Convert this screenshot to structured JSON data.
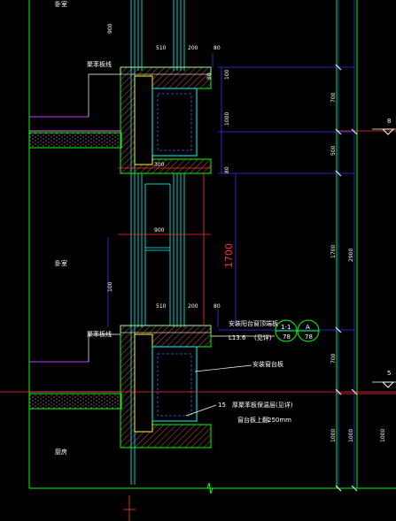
{
  "drawing": {
    "rooms": {
      "top": "卧室",
      "middle": "卧室",
      "bottom": "厨房"
    },
    "labels": {
      "mortar_upper": "聚苯板线",
      "mortar_lower": "聚苯板线",
      "note1": "安装阳台窗顶端板",
      "note1_sub": "L13.6",
      "note1_paren": "(见详)",
      "note2": "安装窗台板",
      "note3_num": "15",
      "note3": "厚聚苯板保温层(见详)",
      "note3_sub": "窗台板上翻",
      "note3_val": "250mm"
    },
    "callouts": [
      {
        "top": "1-1",
        "bottom": "78"
      },
      {
        "top": "A",
        "bottom": "78"
      }
    ],
    "dimensions": {
      "top_900": "900",
      "w510_top": "510",
      "w200_top": "200",
      "w80_top": "80",
      "h100_a": "100",
      "h80_a": "80",
      "h1000": "1000",
      "w300": "300",
      "w80_b": "80",
      "w900": "900",
      "h1700": "1700",
      "w510_bot": "510",
      "w200_bot": "200",
      "w80_bot": "80",
      "h100_b": "100",
      "h80_b": "80",
      "left_100": "100",
      "r_700": "700",
      "r_500": "500",
      "r_1700": "1700",
      "r_2900": "2900",
      "r_100": "100",
      "r_1000a": "1000",
      "r_1000b": "1000",
      "r_1000c": "1000",
      "r_700b": "700"
    },
    "markers": {
      "upper": "8",
      "lower": "5"
    },
    "colors": {
      "background": "#000000",
      "wall": "#00ff00",
      "window": "#00ffff",
      "hatch": "#ff8080",
      "dimension_blue": "#3333ff",
      "dimension_red": "#ff3333",
      "leader": "#ffffff",
      "accent_magenta": "#cc33ff",
      "yellow": "#ffff00"
    }
  }
}
